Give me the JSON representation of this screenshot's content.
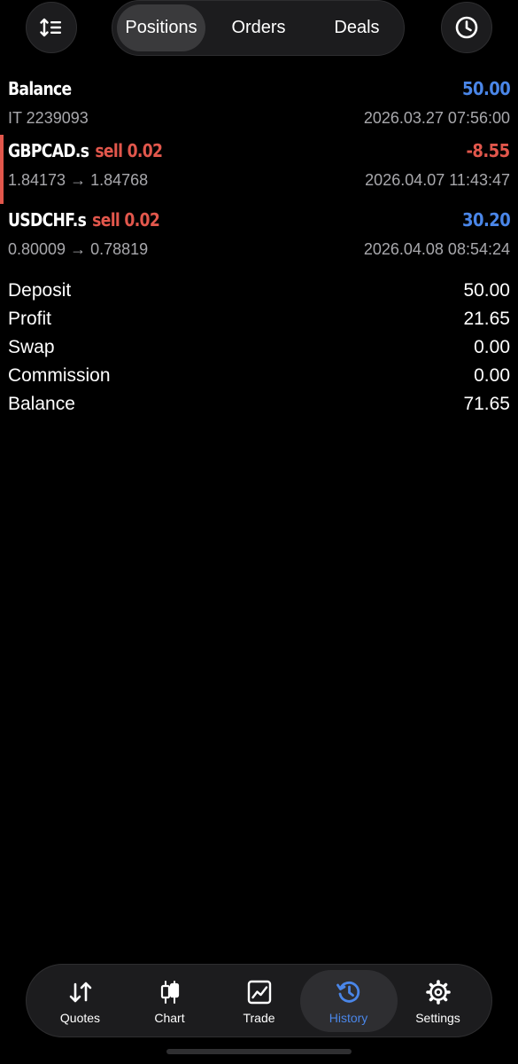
{
  "header": {
    "sort_icon": "sort-icon",
    "clock_icon": "clock-icon",
    "tabs": [
      {
        "label": "Positions",
        "active": true
      },
      {
        "label": "Orders",
        "active": false
      },
      {
        "label": "Deals",
        "active": false
      }
    ]
  },
  "rows": [
    {
      "title": "Balance",
      "side": "",
      "amount": "50.00",
      "amount_color": "#4a86e8",
      "subtitle": "IT 2239093",
      "time": "2026.03.27 07:56:00"
    },
    {
      "title": "GBPCAD.s",
      "side": "sell 0.02",
      "amount": "-8.55",
      "amount_color": "#e2574c",
      "subtitle": "1.84173 → 1.84768",
      "time": "2026.04.07 11:43:47",
      "highlighted": true
    },
    {
      "title": "USDCHF.s",
      "side": "sell 0.02",
      "amount": "30.20",
      "amount_color": "#4a86e8",
      "subtitle": "0.80009 → 0.78819",
      "time": "2026.04.08 08:54:24"
    }
  ],
  "summary": [
    {
      "label": "Deposit",
      "value": "50.00"
    },
    {
      "label": "Profit",
      "value": "21.65"
    },
    {
      "label": "Swap",
      "value": "0.00"
    },
    {
      "label": "Commission",
      "value": "0.00"
    },
    {
      "label": "Balance",
      "value": "71.65"
    }
  ],
  "nav": {
    "items": [
      {
        "label": "Quotes",
        "icon": "quotes-icon"
      },
      {
        "label": "Chart",
        "icon": "candlestick-icon"
      },
      {
        "label": "Trade",
        "icon": "trade-icon"
      },
      {
        "label": "History",
        "icon": "history-icon",
        "active": true
      },
      {
        "label": "Settings",
        "icon": "gear-icon"
      }
    ]
  },
  "colors": {
    "background": "#000000",
    "profit_blue": "#4a86e8",
    "loss_red": "#e2574c",
    "muted_text": "#a8a8ac"
  }
}
